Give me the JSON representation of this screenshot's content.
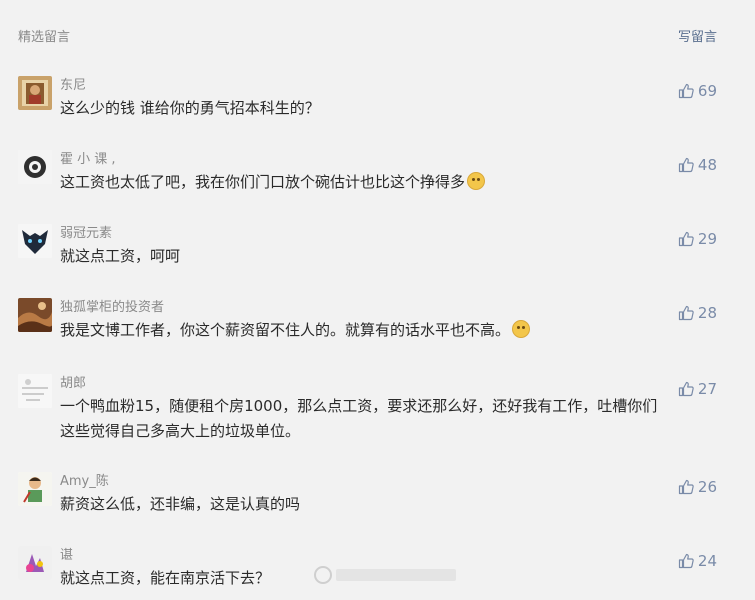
{
  "header": {
    "title": "精选留言",
    "write_label": "写留言"
  },
  "comments": [
    {
      "nickname": "东尼",
      "text": "这么少的钱 谁给你的勇气招本科生的？",
      "likes": "69",
      "avatar": "framed-portrait"
    },
    {
      "nickname": "霍 小 课 ,",
      "text": "这工资也太低了吧，我在你们门口放个碗估计也比这个挣得多",
      "likes": "48",
      "avatar": "dark-circle-logo"
    },
    {
      "nickname": "弱冠元素",
      "text": "就这点工资，呵呵",
      "likes": "29",
      "avatar": "dark-fox-mask"
    },
    {
      "nickname": "独孤掌柜的投资者",
      "text": "我是文博工作者，你这个薪资留不住人的。就算有的话水平也不高。",
      "likes": "28",
      "avatar": "brown-landscape"
    },
    {
      "nickname": "胡郎",
      "text": "一个鸭血粉15，随便租个房1000，那么点工资，要求还那么好，还好我有工作，吐槽你们这些觉得自己多高大上的垃圾单位。",
      "likes": "27",
      "avatar": "light-sketch"
    },
    {
      "nickname": "Amy_陈",
      "text": "薪资这么低，还非编，这是认真的吗",
      "likes": "26",
      "avatar": "cartoon-figure"
    },
    {
      "nickname": "谌",
      "text": "就这点工资，能在南京活下去？",
      "likes": "24",
      "avatar": "purple-pink-graphic"
    }
  ]
}
